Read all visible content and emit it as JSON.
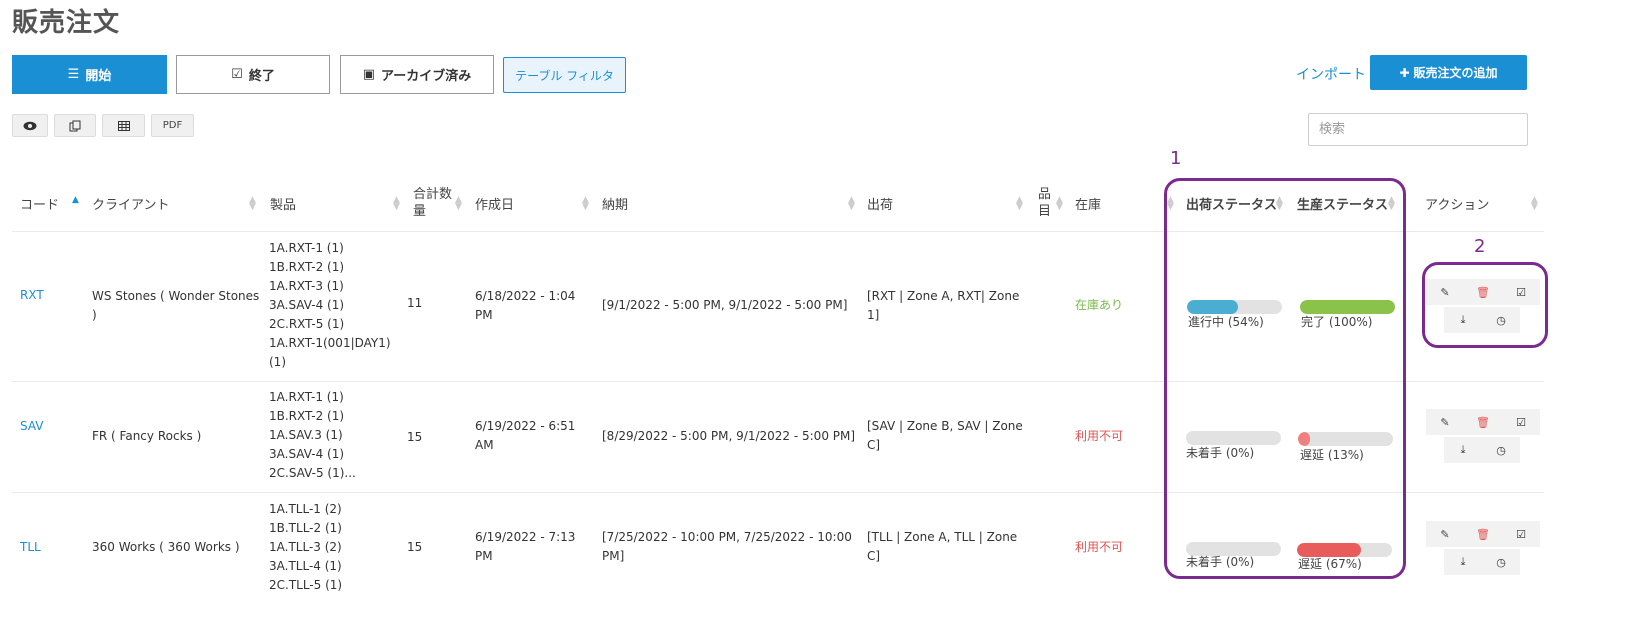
{
  "page": {
    "title": "販売注文"
  },
  "tabs": [
    {
      "label": "開始",
      "icon": "list-icon"
    },
    {
      "label": "終了",
      "icon": "check-square-icon"
    },
    {
      "label": "アーカイブ済み",
      "icon": "inbox-icon"
    }
  ],
  "filter_label": "テーブル フィルタ",
  "import_label": "インポート",
  "add_label": "販売注文の追加",
  "tools": {
    "pdf": "PDF"
  },
  "search": {
    "placeholder": "検索"
  },
  "columns": {
    "code": "コード",
    "client": "クライアント",
    "product": "製品",
    "total_a": "合計数",
    "total_b": "量",
    "created": "作成日",
    "due": "納期",
    "shipment": "出荷",
    "item_a": "品",
    "item_b": "目",
    "stock": "在庫",
    "ship_status": "出荷ステータス",
    "prod_status": "生産ステータス",
    "actions": "アクション"
  },
  "rows": [
    {
      "code": "RXT",
      "client_a": "WS Stones ( Wonder Stones",
      "client_b": ")",
      "products": [
        "1A.RXT-1 (1)",
        "1B.RXT-2 (1)",
        "1A.RXT-3 (1)",
        "3A.SAV-4 (1)",
        "2C.RXT-5 (1)",
        "1A.RXT-1(001|DAY1)",
        "(1)"
      ],
      "qty": "11",
      "created_a": "6/18/2022 - 1:04",
      "created_b": "PM",
      "due": "[9/1/2022 - 5:00 PM, 9/1/2022 - 5:00 PM]",
      "ship_a": "[RXT | Zone A, RXT| Zone",
      "ship_b": "1]",
      "stock": "在庫あり",
      "ship_status": "進行中 (54%)",
      "ship_pct": 54,
      "ship_color": "#4aaed3",
      "prod_status": "完了 (100%)",
      "prod_pct": 100,
      "prod_color": "#8bc34a"
    },
    {
      "code": "SAV",
      "client_a": "FR ( Fancy Rocks )",
      "client_b": "",
      "products": [
        "1A.RXT-1 (1)",
        "1B.RXT-2 (1)",
        "1A.SAV.3 (1)",
        "3A.SAV-4 (1)",
        "2C.SAV-5 (1)..."
      ],
      "qty": "15",
      "created_a": "6/19/2022 - 6:51",
      "created_b": "AM",
      "due": "[8/29/2022 - 5:00 PM, 9/1/2022 - 5:00 PM]",
      "ship_a": "[SAV | Zone B, SAV | Zone",
      "ship_b": "C]",
      "stock": "利用不可",
      "ship_status": "未着手 (0%)",
      "ship_pct": 0,
      "ship_color": "#bdbdbd",
      "prod_status": "遅延 (13%)",
      "prod_pct": 13,
      "prod_color": "#f08080"
    },
    {
      "code": "TLL",
      "client_a": "360 Works ( 360 Works )",
      "client_b": "",
      "products": [
        "1A.TLL-1 (2)",
        "1B.TLL-2 (1)",
        "1A.TLL-3 (2)",
        "3A.TLL-4 (1)",
        "2C.TLL-5 (1)"
      ],
      "qty": "15",
      "created_a": "6/19/2022 - 7:13",
      "created_b": "PM",
      "due_a": "[7/25/2022 - 10:00 PM, 7/25/2022 - 10:00",
      "due_b": "PM]",
      "ship_a": "[TLL | Zone A, TLL | Zone",
      "ship_b": "C]",
      "stock": "利用不可",
      "ship_status": "未着手 (0%)",
      "ship_pct": 0,
      "ship_color": "#bdbdbd",
      "prod_status": "遅延 (67%)",
      "prod_pct": 67,
      "prod_color": "#e85c5c"
    }
  ],
  "callouts": {
    "one": "1",
    "two": "2"
  }
}
